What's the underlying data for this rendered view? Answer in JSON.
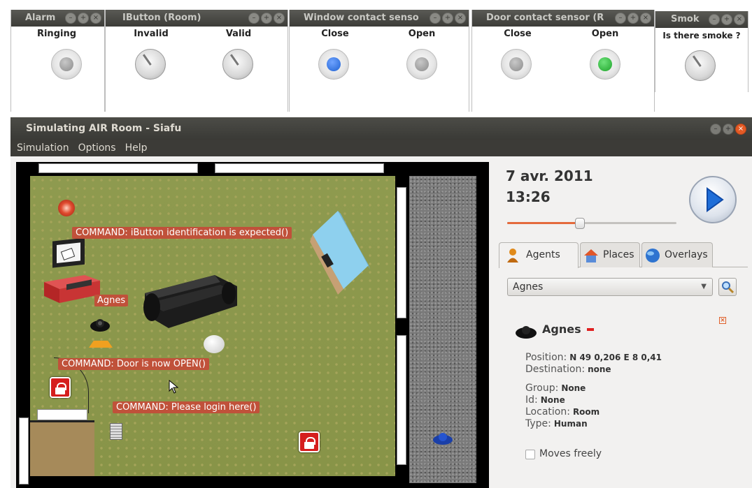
{
  "sensors": [
    {
      "title": "Alarm",
      "states": [
        "Ringing"
      ]
    },
    {
      "title": "IButton (Room)",
      "states": [
        "Invalid",
        "Valid"
      ]
    },
    {
      "title": "Window contact senso",
      "states": [
        "Close",
        "Open"
      ]
    },
    {
      "title": "Door contact sensor (R",
      "states": [
        "Close",
        "Open"
      ]
    },
    {
      "title": "Smok",
      "states": [
        "Is there smoke ?"
      ]
    }
  ],
  "panel_buttons": {
    "minimize": "–",
    "maximize": "+",
    "close": "×"
  },
  "led_colors": {
    "off": "#8b8b8b",
    "close_active": "#1f62d1",
    "open_active": "#1ea32a"
  },
  "window": {
    "title": "Simulating AIR Room - Siafu"
  },
  "menu": [
    "Simulation",
    "Options",
    "Help"
  ],
  "map": {
    "commands": [
      "COMMAND: iButton identification is expected()",
      "COMMAND: Door is now OPEN()",
      "COMMAND: Please login here()"
    ],
    "agent_label": "Agnes"
  },
  "clock": {
    "date": "7 avr. 2011",
    "time": "13:26",
    "speed_fraction": 0.43
  },
  "tabs": [
    {
      "label": "Agents",
      "icon": "agent-icon"
    },
    {
      "label": "Places",
      "icon": "house-icon"
    },
    {
      "label": "Overlays",
      "icon": "globe-icon"
    }
  ],
  "agent_select": {
    "value": "Agnes"
  },
  "agent_details": {
    "name": "Agnes",
    "position_label": "Position:",
    "position": "N 49 0,206 E 8 0,41",
    "destination_label": "Destination:",
    "destination": "none",
    "group_label": "Group:",
    "group": "None",
    "id_label": "Id:",
    "id": "None",
    "location_label": "Location:",
    "location": "Room",
    "type_label": "Type:",
    "type": "Human",
    "moves_freely": "Moves freely"
  },
  "accent": "#e46a3c"
}
